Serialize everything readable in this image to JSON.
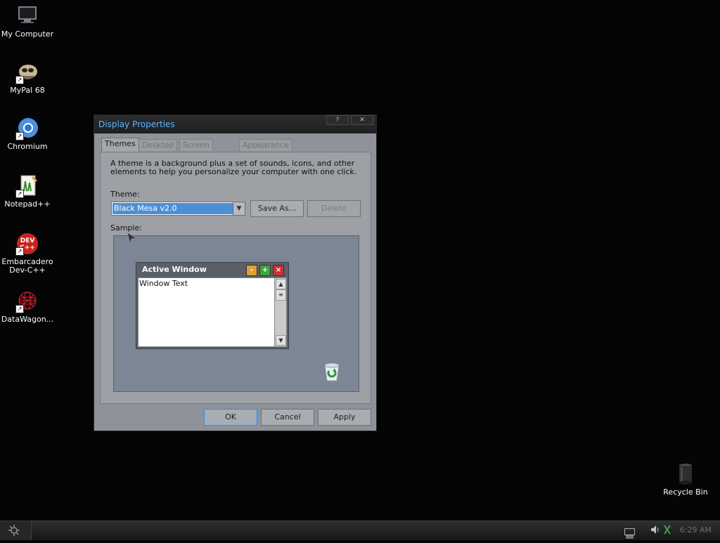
{
  "desktop": {
    "icons": [
      {
        "label": "My Computer"
      },
      {
        "label": "MyPal 68"
      },
      {
        "label": "Chromium"
      },
      {
        "label": "Notepad++"
      },
      {
        "label": "Embarcadero Dev-C++"
      },
      {
        "label": "DataWagon..."
      },
      {
        "label": "Recycle Bin"
      }
    ]
  },
  "window": {
    "title": "Display Properties",
    "help_label": "?",
    "close_label": "✕",
    "tabs": [
      {
        "label": "Themes",
        "active": true
      },
      {
        "label": "Desktop"
      },
      {
        "label": "Screen Saver"
      },
      {
        "label": "Appearance"
      }
    ],
    "description": "A theme is a background plus a set of sounds, icons, and other elements to help you personalize your computer with one click.",
    "theme_label": "Theme:",
    "theme_value": "Black Mesa v2.0",
    "save_as_label": "Save As...",
    "delete_label": "Delete",
    "sample_label": "Sample:",
    "sample": {
      "window_title": "Active Window",
      "window_text": "Window Text"
    },
    "ok_label": "OK",
    "cancel_label": "Cancel",
    "apply_label": "Apply"
  },
  "taskbar": {
    "clock": "6:29 AM"
  },
  "colors": {
    "title_text": "#5fb2ff",
    "selection": "#4d8fd6",
    "desktop_bg": "#050505"
  }
}
